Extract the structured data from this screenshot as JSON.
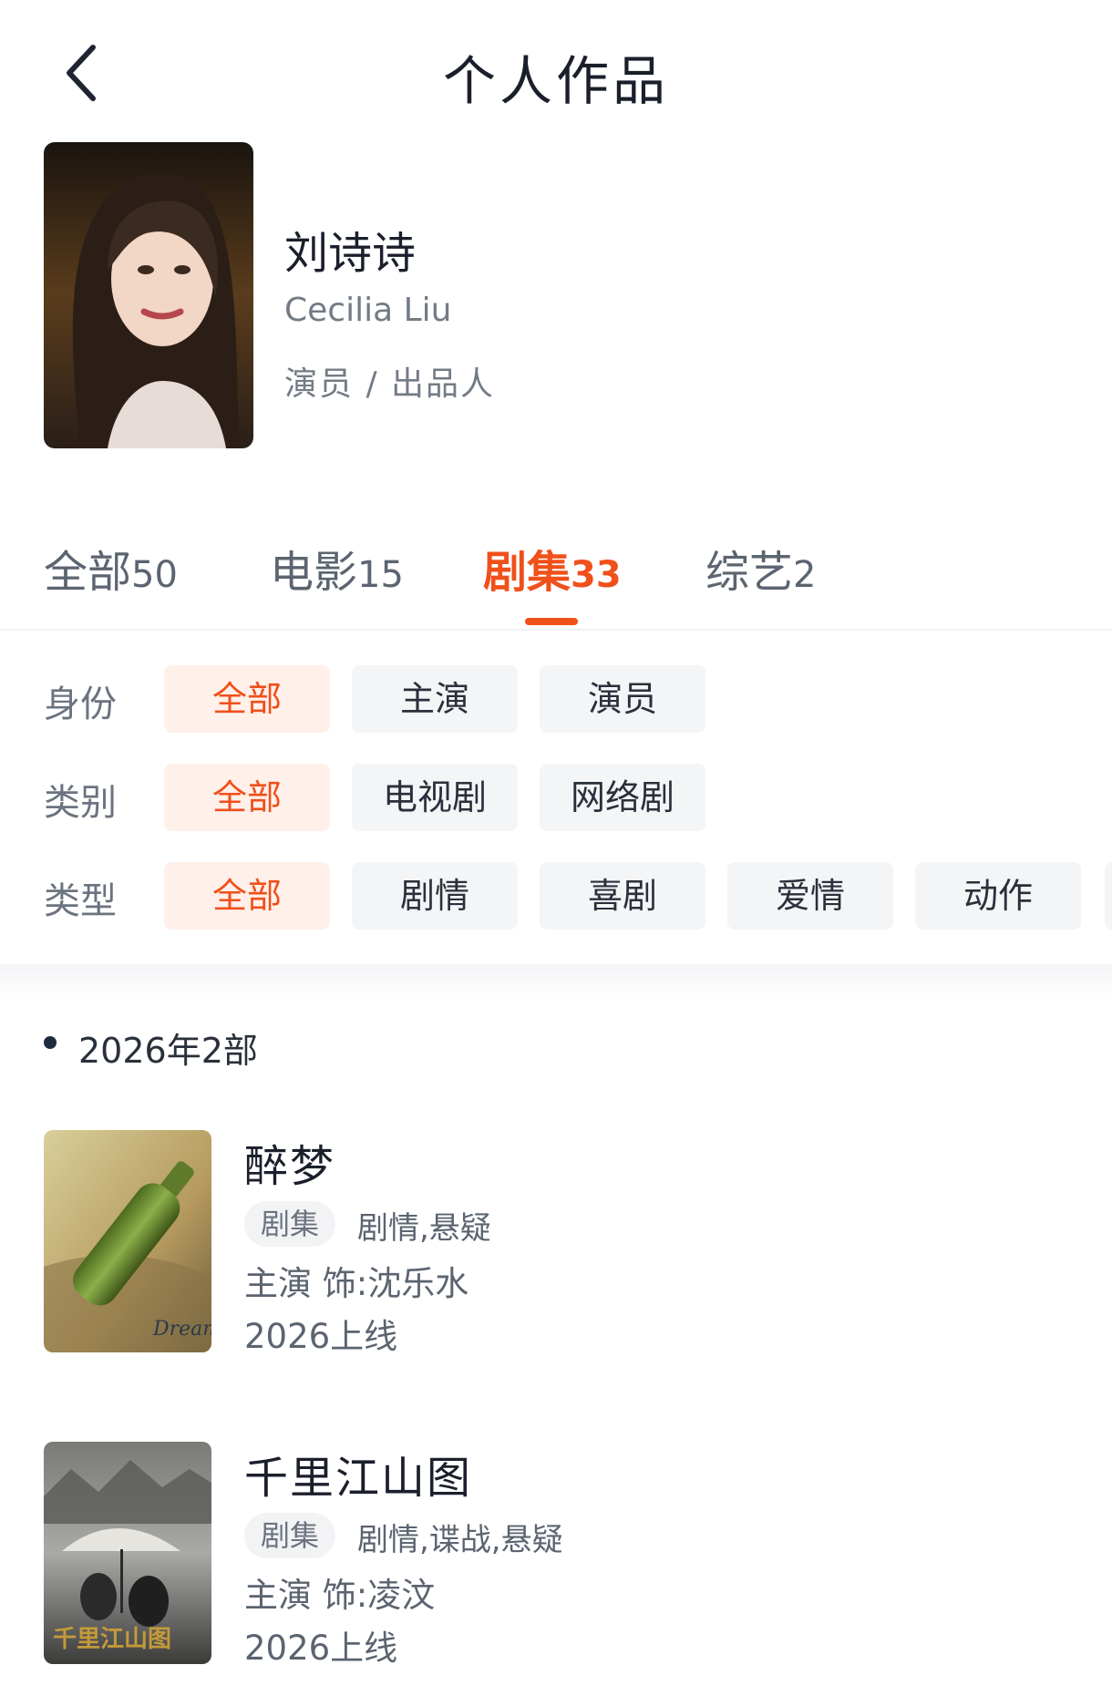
{
  "header": {
    "title": "个人作品"
  },
  "profile": {
    "name": "刘诗诗",
    "english_name": "Cecilia Liu",
    "roles": "演员 / 出品人"
  },
  "tabs": [
    {
      "label": "全部",
      "count": "50",
      "active": false
    },
    {
      "label": "电影",
      "count": "15",
      "active": false
    },
    {
      "label": "剧集",
      "count": "33",
      "active": true
    },
    {
      "label": "综艺",
      "count": "2",
      "active": false
    }
  ],
  "filters": {
    "identity": {
      "label": "身份",
      "options": [
        "全部",
        "主演",
        "演员"
      ],
      "selected": "全部"
    },
    "category": {
      "label": "类别",
      "options": [
        "全部",
        "电视剧",
        "网络剧"
      ],
      "selected": "全部"
    },
    "genre": {
      "label": "类型",
      "options": [
        "全部",
        "剧情",
        "喜剧",
        "爱情",
        "动作"
      ],
      "selected": "全部"
    }
  },
  "year_group": {
    "label": "2026年2部"
  },
  "works": [
    {
      "title": "醉梦",
      "tag": "剧集",
      "genres": "剧情,悬疑",
      "role": "主演  饰:沈乐水",
      "release": "2026上线"
    },
    {
      "title": "千里江山图",
      "tag": "剧集",
      "genres": "剧情,谍战,悬疑",
      "role": "主演  饰:凌汶",
      "release": "2026上线"
    }
  ],
  "colors": {
    "accent": "#f0501a",
    "chip_selected_bg": "#fff0ea",
    "chip_bg": "#f4f5f7",
    "text_primary": "#1a1f2b",
    "text_secondary": "#737b86"
  },
  "icons": {
    "back": "chevron-left-icon"
  }
}
